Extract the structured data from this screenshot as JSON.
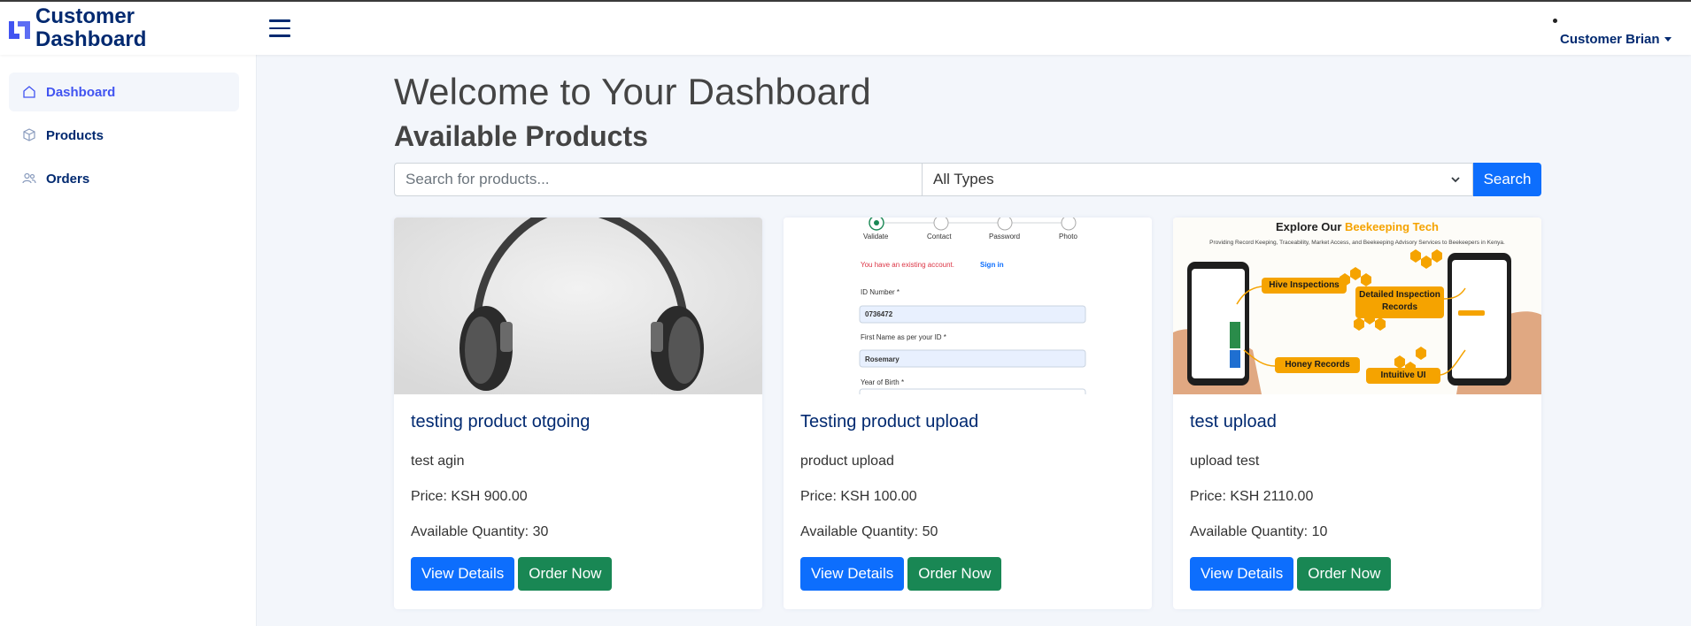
{
  "header": {
    "logo_line1": "Customer",
    "logo_line2": "Dashboard",
    "user_name": "Customer Brian"
  },
  "sidebar": {
    "items": [
      {
        "label": "Dashboard",
        "icon": "home-icon",
        "active": true
      },
      {
        "label": "Products",
        "icon": "box-icon",
        "active": false
      },
      {
        "label": "Orders",
        "icon": "people-icon",
        "active": false
      }
    ]
  },
  "main": {
    "welcome": "Welcome to Your Dashboard",
    "subtitle": "Available Products",
    "search": {
      "placeholder": "Search for products...",
      "type_selected": "All Types",
      "button_label": "Search"
    },
    "products": [
      {
        "title": "testing product otgoing",
        "description": "test agin",
        "price": "Price: KSH 900.00",
        "quantity": "Available Quantity: 30",
        "view_label": "View Details",
        "order_label": "Order Now"
      },
      {
        "title": "Testing product upload",
        "description": "product upload",
        "price": "Price: KSH 100.00",
        "quantity": "Available Quantity: 50",
        "view_label": "View Details",
        "order_label": "Order Now",
        "image_text": {
          "steps": [
            "Validate",
            "Contact",
            "Password",
            "Photo"
          ],
          "notice": "You have an existing account.",
          "signin": "Sign in",
          "id_label": "ID Number *",
          "id_value": "0736472",
          "first_name_label": "First Name as per your ID *",
          "first_name_value": "Rosemary",
          "year_label": "Year of Birth *"
        }
      },
      {
        "title": "test upload",
        "description": "upload test",
        "price": "Price: KSH 2110.00",
        "quantity": "Available Quantity: 10",
        "view_label": "View Details",
        "order_label": "Order Now",
        "image_text": {
          "heading_a": "Explore Our ",
          "heading_b": "Beekeeping Tech",
          "tagline": "Providing Record Keeping, Traceability, Market Access, and Beekeeping Advisory Services to Beekeepers in Kenya.",
          "tag1": "Hive Inspections",
          "tag2a": "Detailed Inspection",
          "tag2b": "Records",
          "tag3": "Honey Records",
          "tag4": "Intuitive UI"
        }
      }
    ]
  },
  "colors": {
    "brand": "#012970",
    "accent": "#4154f1",
    "primary": "#0d6efd",
    "success": "#198754",
    "honey": "#f5a300"
  }
}
